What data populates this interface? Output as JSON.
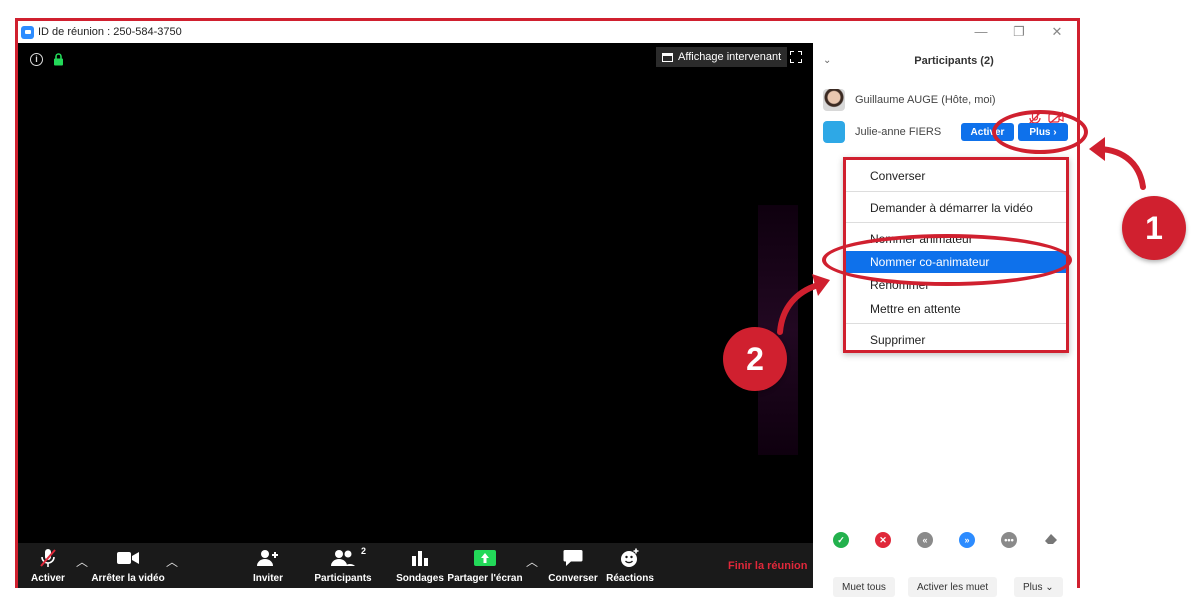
{
  "window": {
    "meeting_id": "ID de réunion : 250-584-3750",
    "minimize": "—",
    "restore": "❐",
    "close": "✕"
  },
  "video": {
    "view_button": "Affichage intervenant"
  },
  "toolbar": {
    "mute": "Activer",
    "stop_video": "Arrêter la vidéo",
    "invite": "Inviter",
    "participants": "Participants",
    "participants_count": "2",
    "polls": "Sondages",
    "share": "Partager l'écran",
    "chat": "Converser",
    "reactions": "Réactions",
    "end": "Finir la réunion"
  },
  "panel": {
    "title": "Participants (2)",
    "participants": [
      {
        "name": "Guillaume AUGE (Hôte, moi)"
      },
      {
        "name": "Julie-anne FIERS"
      }
    ],
    "unmute_button": "Activer",
    "more_button": "Plus",
    "bottom": {
      "mute_all": "Muet tous",
      "unmute_all": "Activer les muet",
      "more": "Plus"
    }
  },
  "context_menu": {
    "items": [
      "Converser",
      "Demander à démarrer la vidéo",
      "Nommer animateur",
      "Nommer co-animateur",
      "Renommer",
      "Mettre en attente",
      "Supprimer"
    ],
    "selected_index": 3
  },
  "annotations": {
    "step1": "1",
    "step2": "2",
    "color": "#d0202f"
  },
  "colors": {
    "accent": "#0e71eb",
    "share_green": "#23d959",
    "end_red": "#e0283a"
  }
}
